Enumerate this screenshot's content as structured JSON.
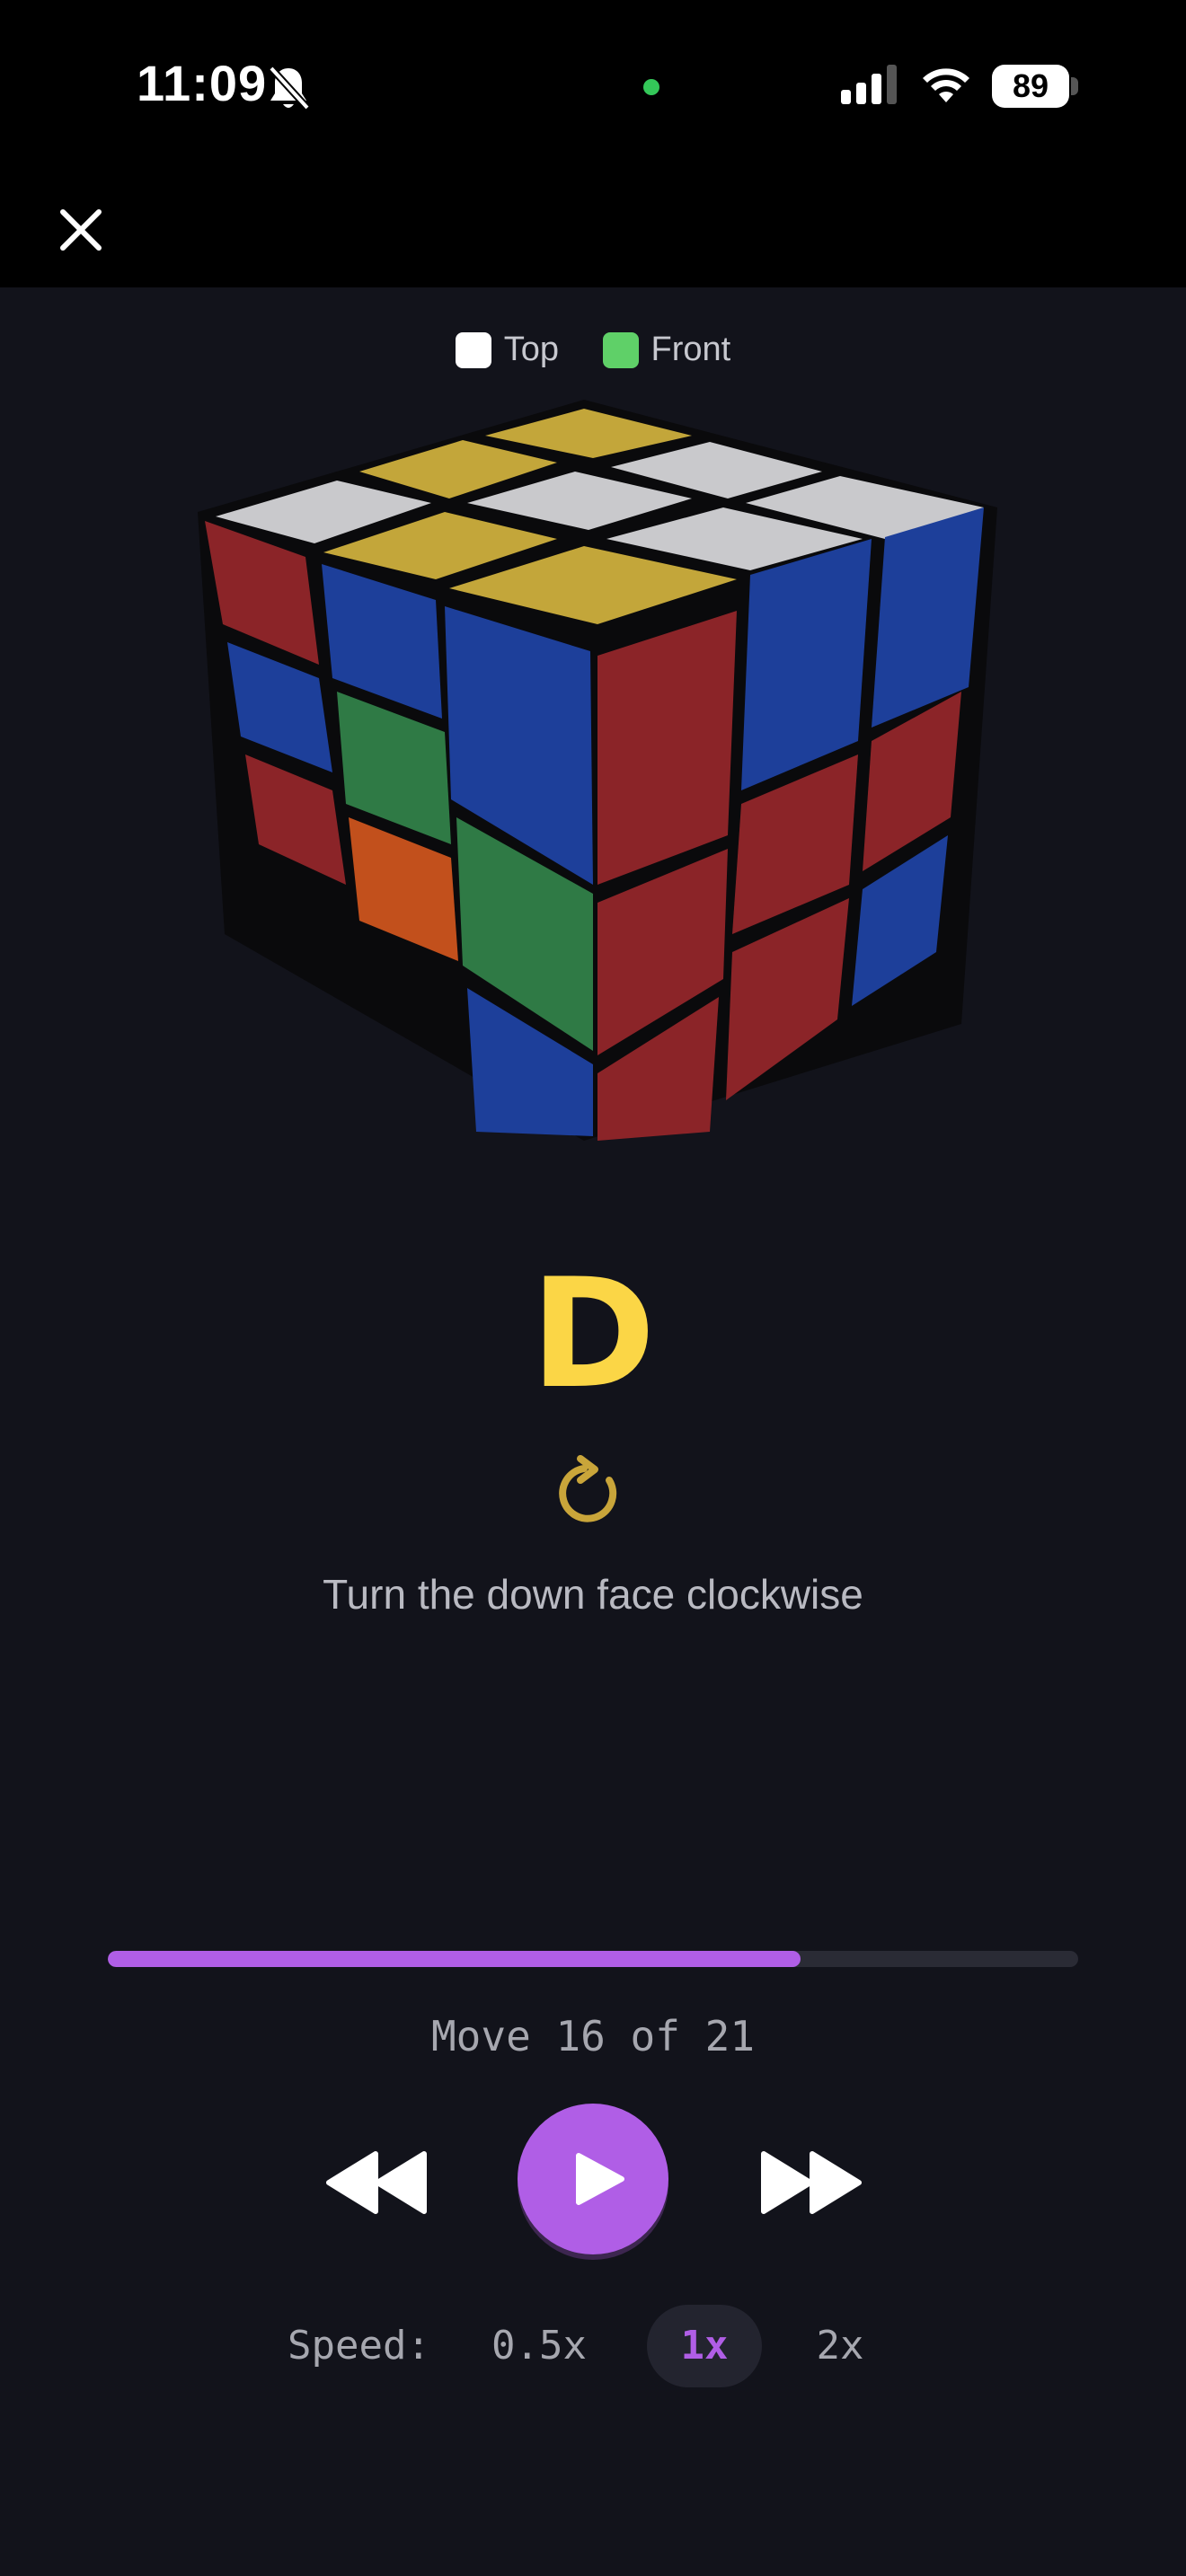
{
  "status_bar": {
    "time": "11:09",
    "battery": "89",
    "icons": [
      "bell-slash-icon",
      "signal-icon",
      "wifi-icon",
      "battery-icon"
    ],
    "privacy_dot_color": "#34c759"
  },
  "header": {
    "close_icon": "close-icon"
  },
  "legend": [
    {
      "label": "Top",
      "color": "#ffffff"
    },
    {
      "label": "Front",
      "color": "#5fd068"
    }
  ],
  "move": {
    "notation": "D",
    "direction_icon": "rotate-clockwise-icon",
    "instruction": "Turn the down face clockwise"
  },
  "progress": {
    "current": 16,
    "total": 21,
    "fraction": 0.714,
    "label": "Move 16 of 21"
  },
  "controls": {
    "rewind_icon": "rewind-icon",
    "play_icon": "play-icon",
    "fast_forward_icon": "fast-forward-icon"
  },
  "speed": {
    "label": "Speed:",
    "options": [
      "0.5x",
      "1x",
      "2x"
    ],
    "selected": "1x"
  },
  "colors": {
    "accent": "#b05ee6",
    "move_letter": "#fbd646",
    "background": "#12131b"
  }
}
